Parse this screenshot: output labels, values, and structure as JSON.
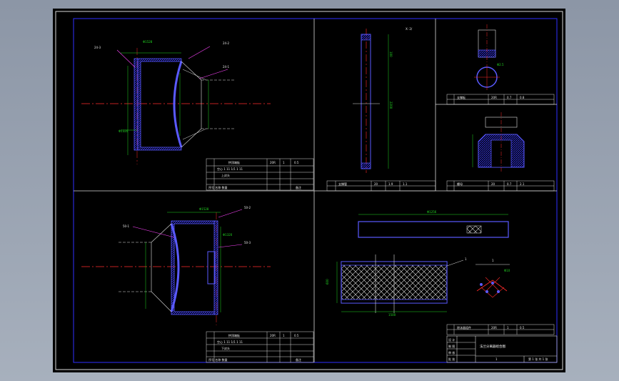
{
  "labels": {
    "p24_3": "24-3",
    "p24_2": "24-2",
    "p24_1": "24-1",
    "p50_1": "50-1",
    "p50_2": "50-2",
    "p50_3": "50-3",
    "scale_note": "X: 2/",
    "part1": "1",
    "detail_1": "1"
  },
  "dims": {
    "d_top_left": "Φ1528",
    "d_bot_left": "Φ1320",
    "d_top_lower": "Φ1528",
    "d_mid_lower": "Φ1320",
    "d_vert_mid": "2200",
    "d_vert_top": "100",
    "d_long_top": "Φ1256",
    "d_long_bot": "1500",
    "d_height_mesh": "600",
    "d_detail": "Φ2.5",
    "d_ang": "Φ10"
  },
  "tables": {
    "tl": {
      "r1": "拱顶端板",
      "r2": "空心 1 11 1/1 1 11",
      "r3": "上封头",
      "r4": "序号 名称 数量",
      "c1": "20R",
      "c2": "1",
      "c3": "0.5",
      "c4": "备注"
    },
    "ml": {
      "r1": "拱顶端板",
      "r2": "空心 1 11 1/1 1 11",
      "r3": "下封头",
      "r4": "序号 名称 数量",
      "c1": "20R",
      "c2": "1",
      "c3": "0.5",
      "c4": "备注"
    },
    "mid": {
      "r1": "支撑管",
      "c1": "20",
      "c2": "1.9",
      "c3": "1.1"
    },
    "tr1": {
      "r1": "支撑板",
      "c1": "20R",
      "c2": "0.7",
      "c3": "0.8"
    },
    "tr2": {
      "r1": "螺母",
      "c1": "20",
      "c2": "0.7",
      "c3": "2.1"
    },
    "br": {
      "r1": "除沫器组件",
      "c1": "20R",
      "c2": "1",
      "c3": "0.5"
    },
    "title": {
      "c1": "设 计",
      "c2": "制 图",
      "c3": "审 核",
      "c4": "批 准",
      "name": "法兰分离器组合图",
      "sheet": "第 1 张 共 1 张",
      "ver": "1"
    }
  }
}
